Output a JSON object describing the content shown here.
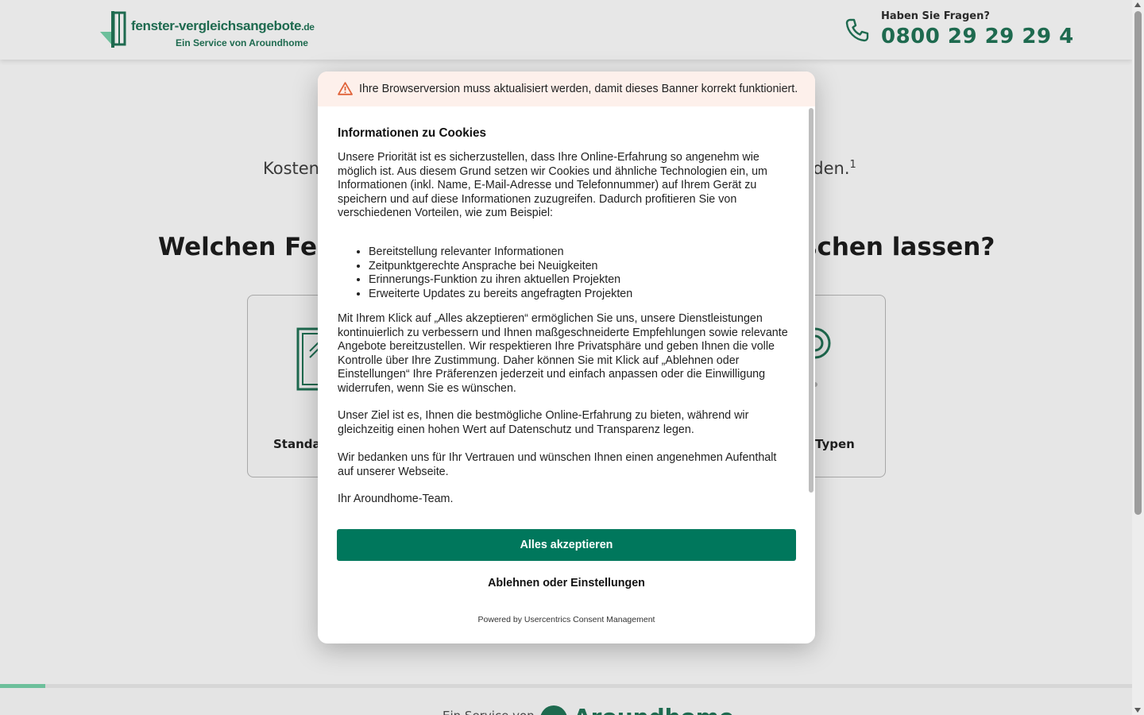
{
  "header": {
    "logo_title": "fenster-vergleichsangebote",
    "logo_tld": ".de",
    "logo_subtitle": "Ein Service von Aroundhome",
    "contact_question": "Haben Sie Fragen?",
    "contact_phone": "0800 29 29 29 4"
  },
  "hero": {
    "subtitle_left": "Kosten",
    "subtitle_right": "nden.",
    "subtitle_footnote": "1",
    "question_left": "Welchen Fens",
    "question_right": "schen lassen?"
  },
  "options": [
    {
      "label": "Standar",
      "icon": "window-icon"
    },
    {
      "label": "Typen",
      "icon": "target-icon"
    }
  ],
  "progress": {
    "percent": 4
  },
  "footer": {
    "service_text": "Ein Service von",
    "brand": "Aroundhome"
  },
  "consent": {
    "warning": "Ihre Browserversion muss aktualisiert werden, damit dieses Banner korrekt funktioniert.",
    "title": "Informationen zu Cookies",
    "intro": "Unsere Priorität ist es sicherzustellen, dass Ihre Online-Erfahrung so angenehm wie möglich ist. Aus diesem Grund setzen wir Cookies und ähnliche Technologien ein, um Informationen (inkl. Name, E-Mail-Adresse und Telefonnummer) auf Ihrem Gerät zu speichern und auf diese Informationen zuzugreifen. Dadurch profitieren Sie von verschiedenen Vorteilen, wie zum Beispiel:",
    "benefits": [
      "Bereitstellung relevanter Informationen",
      "Zeitpunktgerechte Ansprache bei Neuigkeiten",
      "Erinnerungs-Funktion zu ihren aktuellen Projekten",
      "Erweiterte Updates zu bereits angefragten Projekten"
    ],
    "consent_text": "Mit Ihrem Klick auf „Alles akzeptieren“ ermöglichen Sie uns, unsere Dienstleistungen kontinuierlich zu verbessern und Ihnen maßgeschneiderte Empfehlungen sowie relevante Angebote bereitzustellen. Wir respektieren Ihre Privatsphäre und geben Ihnen die volle Kontrolle über Ihre Zustimmung. Daher können Sie mit Klick auf „Ablehnen oder Einstellungen“ Ihre Präferenzen jederzeit und einfach anpassen oder die Einwilligung widerrufen, wenn Sie es wünschen.",
    "goal_text": "Unser Ziel ist es, Ihnen die bestmögliche Online-Erfahrung zu bieten, während wir gleichzeitig einen hohen Wert auf Datenschutz und Transparenz legen.",
    "thanks_text": "Wir bedanken uns für Ihr Vertrauen und wünschen Ihnen einen angenehmen Aufenthalt auf unserer Webseite.",
    "signature": "Ihr Aroundhome-Team.",
    "accept_label": "Alles akzeptieren",
    "decline_label": "Ablehnen oder Einstellungen",
    "powered_by": "Powered by Usercentrics Consent Management"
  },
  "colors": {
    "brand_green": "#1e6a4f",
    "accept_green": "#00775c",
    "warning_bg": "#fdf0eb",
    "warning_icon": "#e0633a",
    "progress_fill": "#6cbf9b"
  }
}
